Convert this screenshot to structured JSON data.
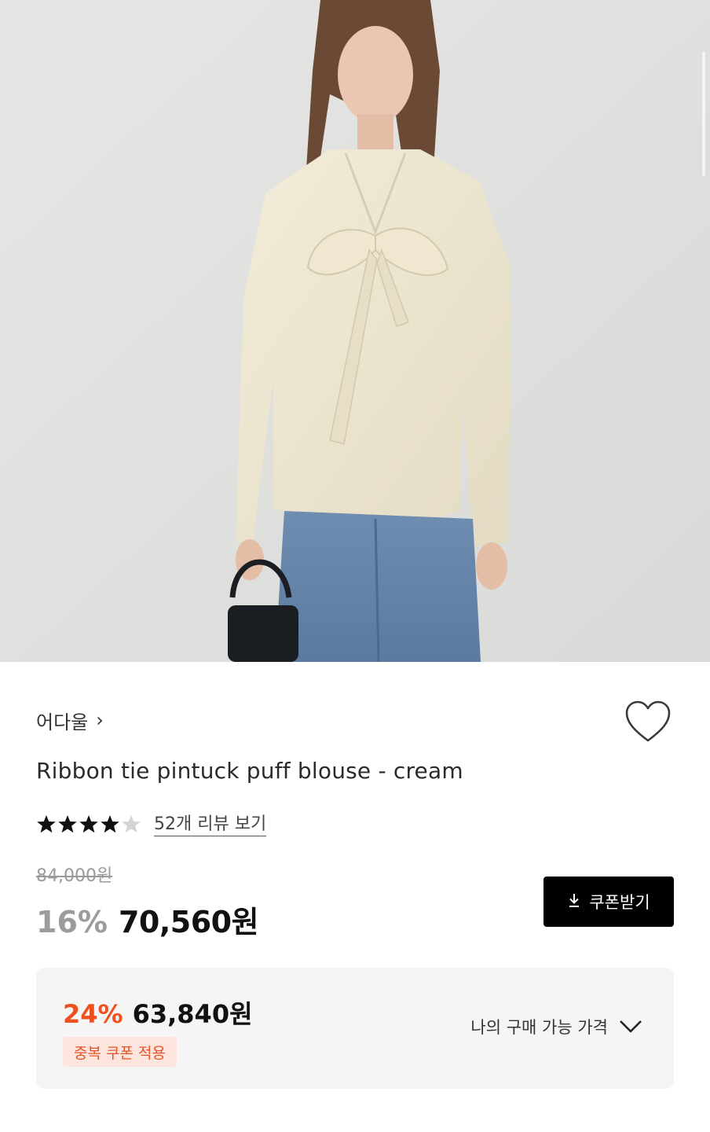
{
  "product_image": {
    "alt_icon": "product-photo"
  },
  "brand": {
    "name": "어다울",
    "chevron": "›"
  },
  "wishlist": {
    "icon": "heart-outline-icon"
  },
  "product": {
    "title": "Ribbon tie pintuck puff blouse - cream"
  },
  "rating": {
    "stars": 4.5,
    "review_link": "52개 리뷰 보기"
  },
  "price": {
    "original": "84,000원",
    "discount": "16%",
    "sale": "70,560원"
  },
  "coupon_button": {
    "icon": "download-icon",
    "label": "쿠폰받기"
  },
  "my_price": {
    "discount": "24%",
    "price": "63,840원",
    "badge": "중복 쿠폰 적용",
    "label": "나의 구매 가능 가격",
    "icon": "chevron-down-icon"
  },
  "colors": {
    "accent": "#f0501e",
    "badge_bg": "#fde5dd",
    "button_bg": "#000000",
    "box_bg": "#f5f5f5"
  }
}
